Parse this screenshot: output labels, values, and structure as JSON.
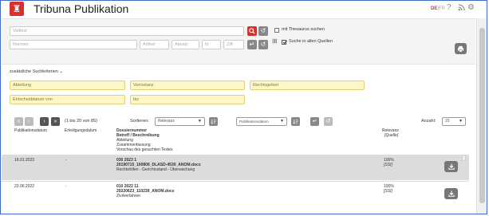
{
  "app": {
    "title": "Tribuna Publikation",
    "logo_icon": "tribuna-logo-icon",
    "accent": "#d9302b"
  },
  "header": {
    "lang_active": "DE",
    "lang_sep": "|",
    "lang_other": "FR",
    "help_glyph": "?",
    "rss_glyph": "⌖",
    "settings_glyph": "⚙"
  },
  "search": {
    "volltext_placeholder": "Volltext",
    "normen_placeholder": "Normen",
    "artikel_placeholder": "Artikel",
    "absatz_placeholder": "Absatz",
    "lit_placeholder": "lit.",
    "ziff_placeholder": "Ziff.",
    "thesaurus_label": "mit Thesaurus suchen",
    "thesaurus_checked": false,
    "alle_quellen_label": "Suche in allen Quellen",
    "alle_quellen_checked": true,
    "plus_glyph": "⊞",
    "search_glyph": "🔍",
    "reset_glyph": "↺",
    "enter_glyph": "↵",
    "print_glyph": "⎙"
  },
  "extra": {
    "toggle_label": "zusätzliche Suchkriterien",
    "toggle_glyph": "⌄",
    "abteilung_placeholder": "Abteilung",
    "vorinstanz_placeholder": "Vorinstanz",
    "rechtsgebiet_placeholder": "Rechtsgebiet",
    "entscheiddatum_von_placeholder": "Entscheiddatum von",
    "bis_placeholder": "bis"
  },
  "results": {
    "pager": {
      "first": "«",
      "prev": "‹",
      "next": "›",
      "last": "»",
      "count_text": "(1 bis 20 von 85)"
    },
    "sort_label": "Sortieren:",
    "sort_value": "Relevanz",
    "sort_field_value": "Publikationsdatum",
    "anzahl_label": "Anzahl:",
    "anzahl_value": "20",
    "columns": {
      "publikationsdatum": "Publikationsdatum",
      "erledigungsdatum": "Erledigungsdatum",
      "doc_line1": "Dossiernummer",
      "doc_line2": "Betreff / Beschreibung",
      "doc_line3": "Abteilung",
      "doc_line4": "Zusammenfassung",
      "doc_line5": "Vorschau des gesuchten Textes",
      "relevanz": "Relevanz",
      "quelle": "[Quelle]"
    },
    "rows": [
      {
        "pub": "18.01.2023",
        "erl": "-",
        "dossier": "030 2023 1",
        "file": "20190715_100809_DLASD-4530_ANOM.docx",
        "betreff": "Rechtshilfen - Gerichtsstand - Überwachung",
        "relevanz": "100%",
        "quelle": "[SSI]",
        "download_glyph": "⭳"
      },
      {
        "pub": "23.06.2022",
        "erl": "-",
        "dossier": "010 2022 11",
        "file": "20220623_110239_ANOM.docx",
        "betreff": "Zivilverfahren",
        "relevanz": "100%",
        "quelle": "[SSI]",
        "download_glyph": "⭳"
      }
    ]
  }
}
